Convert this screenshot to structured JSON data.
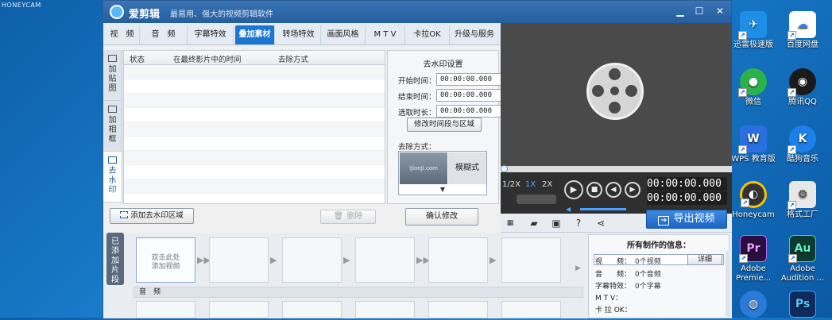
{
  "watermark": "HONEYCAM",
  "window": {
    "app_name": "爱剪辑",
    "slogan": "最易用、强大的视频剪辑软件",
    "minimize": "▁",
    "maximize": "☐",
    "close": "✕"
  },
  "tabs": [
    {
      "label": "视　频"
    },
    {
      "label": "音　频"
    },
    {
      "label": "字幕特效"
    },
    {
      "label": "叠加素材",
      "active": true
    },
    {
      "label": "转场特效"
    },
    {
      "label": "画面风格"
    },
    {
      "label": "M T V"
    },
    {
      "label": "卡拉OK"
    },
    {
      "label": "升级与服务"
    }
  ],
  "side_tabs": [
    {
      "label": "加贴图"
    },
    {
      "label": "加相框"
    },
    {
      "label": "去水印",
      "active": true
    }
  ],
  "table": {
    "headers": [
      "状态",
      "在最终影片中的时间",
      "去除方式"
    ]
  },
  "left_actions": {
    "add_area": "添加去水印区域",
    "delete": "删除"
  },
  "watermark_panel": {
    "title": "去水印设置",
    "start_label": "开始时间：",
    "start_value": "00:00:00.000",
    "end_label": "结束时间：",
    "end_value": "00:00:00.000",
    "duration_label": "选取时长：",
    "duration_value": "00:00:00.000",
    "modify_button": "修改时间段与区域",
    "method_label": "去除方式：",
    "preview_text": "iJionJi.com",
    "method_value": "模糊式",
    "confirm_button": "确认修改"
  },
  "player": {
    "speed_low": "1/2X",
    "speed_normal": "1X",
    "speed_high": "2X",
    "time_current": "00:00:00.000",
    "time_total": "00:00:00.000",
    "export_button": "导出视频"
  },
  "clips": {
    "added_label": "已添加片段",
    "placeholder": "双击此处添加视频",
    "audio_label": "音　频"
  },
  "info_panel": {
    "title": "所有制作的信息：",
    "rows": [
      {
        "label": "视　　频：",
        "value": "0个视频"
      },
      {
        "label": "音　　频：",
        "value": "0个音频"
      },
      {
        "label": "字幕特效：",
        "value": "0个字幕"
      },
      {
        "label": "M T V：",
        "value": ""
      },
      {
        "label": "卡 拉 OK：",
        "value": ""
      }
    ],
    "detail_button": "详细"
  },
  "desktop_icons": [
    {
      "label": "迅雷极速版",
      "color": "#1d8fe6"
    },
    {
      "label": "百度网盘",
      "color": "#2a7ff0"
    },
    {
      "label": "微信",
      "color": "#2bb24c"
    },
    {
      "label": "腾讯QQ",
      "color": "#1a1a1a"
    },
    {
      "label": "WPS 教育版",
      "color": "#2a6ee0"
    },
    {
      "label": "酷狗音乐",
      "color": "#1d7fe8"
    },
    {
      "label": "Honeycam",
      "color": "#333333"
    },
    {
      "label": "格式工厂",
      "color": "#e8e8e8"
    },
    {
      "label": "Adobe Premie...",
      "color": "#2a0e3f"
    },
    {
      "label": "Adobe Audition ...",
      "color": "#0b3b2f"
    },
    {
      "label": "",
      "color": "#2a7bd8"
    },
    {
      "label": "",
      "color": "#0f2a5c"
    }
  ]
}
